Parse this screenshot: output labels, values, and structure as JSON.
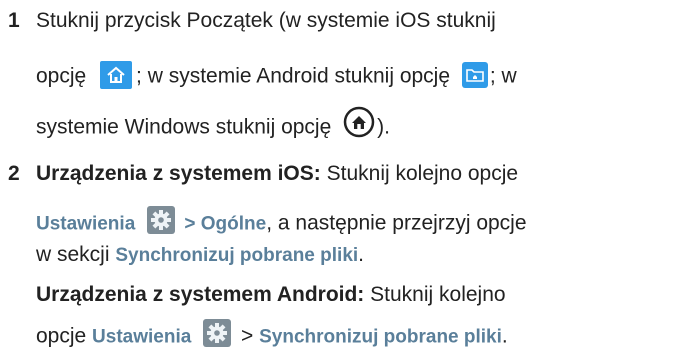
{
  "steps": [
    {
      "number": "1",
      "line1": "Stuknij przycisk Początek (w systemie iOS stuknij",
      "line2_a": "opcję",
      "line2_b": "; w systemie Android stuknij opcję",
      "line2_c": "; w",
      "line3_a": "systemie Windows stuknij opcję",
      "line3_b": ")."
    },
    {
      "number": "2",
      "ios_heading": "Urządzenia z systemem iOS:",
      "ios_text1": " Stuknij kolejno opcje",
      "ios_settings": "Ustawienia",
      "ios_sep": " > ",
      "ios_general": "Ogólne",
      "ios_text2": ", a następnie przejrzyj opcje",
      "ios_text3": "w sekcji ",
      "ios_sync": "Synchronizuj pobrane pliki",
      "ios_end": ".",
      "android_heading": "Urządzenia z systemem Android:",
      "android_text1": " Stuknij kolejno",
      "android_text2": "opcje ",
      "android_settings": "Ustawienia",
      "android_sep": " > ",
      "android_sync": "Synchronizuj pobrane pliki",
      "android_end": "."
    }
  ],
  "icons": {
    "ios_home": "home-icon",
    "android_home": "folder-home-icon",
    "windows_home": "circle-home-icon",
    "settings": "gear-icon"
  },
  "colors": {
    "text": "#222222",
    "ui_label": "#5a7f9a",
    "icon_blue": "#2f9be8",
    "gear_bg": "#7d8c96"
  }
}
